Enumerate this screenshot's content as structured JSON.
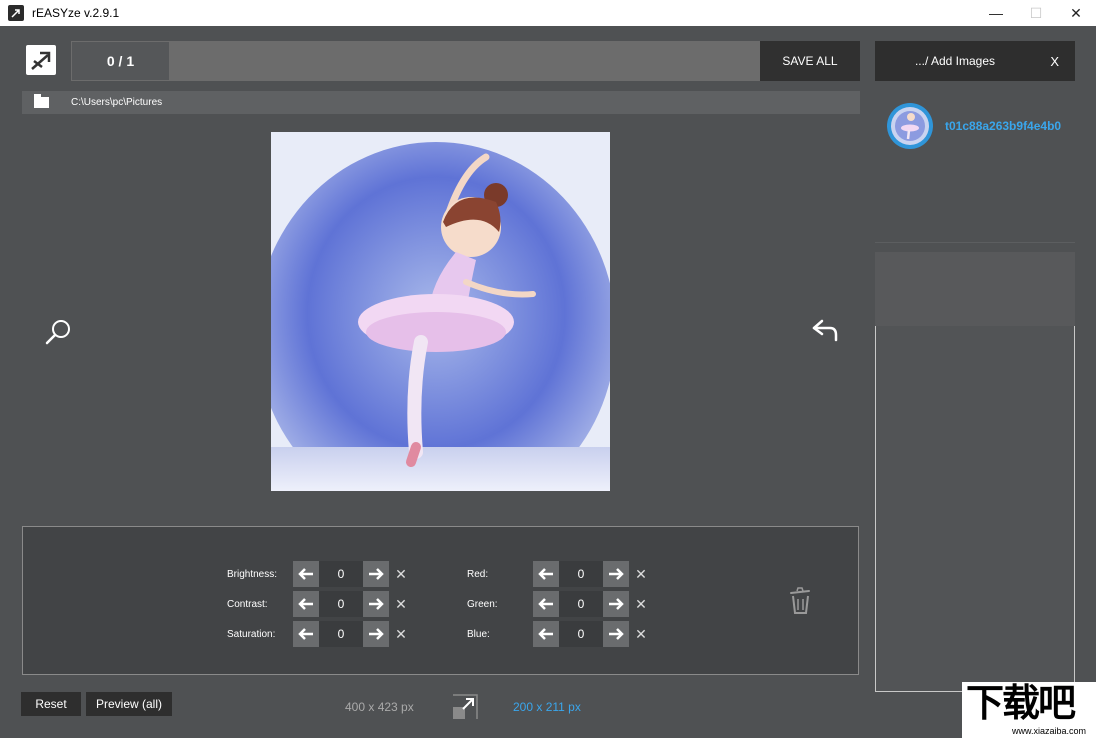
{
  "window": {
    "title": "rEASYze v.2.9.1",
    "controls": [
      "minimize",
      "maximize",
      "close"
    ]
  },
  "toolbar": {
    "counter": "0 / 1",
    "progress": 0,
    "save_all_label": "SAVE ALL"
  },
  "path": {
    "folder_icon": "folder-icon",
    "value": "C:\\Users\\pc\\Pictures"
  },
  "adjustments": {
    "left": [
      {
        "label": "Brightness:",
        "value": "0"
      },
      {
        "label": "Contrast:",
        "value": "0"
      },
      {
        "label": "Saturation:",
        "value": "0"
      }
    ],
    "right": [
      {
        "label": "Red:",
        "value": "0"
      },
      {
        "label": "Green:",
        "value": "0"
      },
      {
        "label": "Blue:",
        "value": "0"
      }
    ],
    "clear_glyph": "✕"
  },
  "bottom": {
    "reset_label": "Reset",
    "preview_label": "Preview (all)",
    "original_size": "400 x 423 px",
    "new_size": "200 x 211 px"
  },
  "sidebar": {
    "add_images_label": ".../ Add Images",
    "close_label": "X",
    "files": [
      {
        "name": "t01c88a263b9f4e4b0("
      }
    ]
  },
  "watermark": {
    "text": "下载吧",
    "url": "www.xiazaiba.com"
  },
  "colors": {
    "background": "#4f5153",
    "accent": "#3aa6ec",
    "button_dark": "#2e2e2e"
  }
}
